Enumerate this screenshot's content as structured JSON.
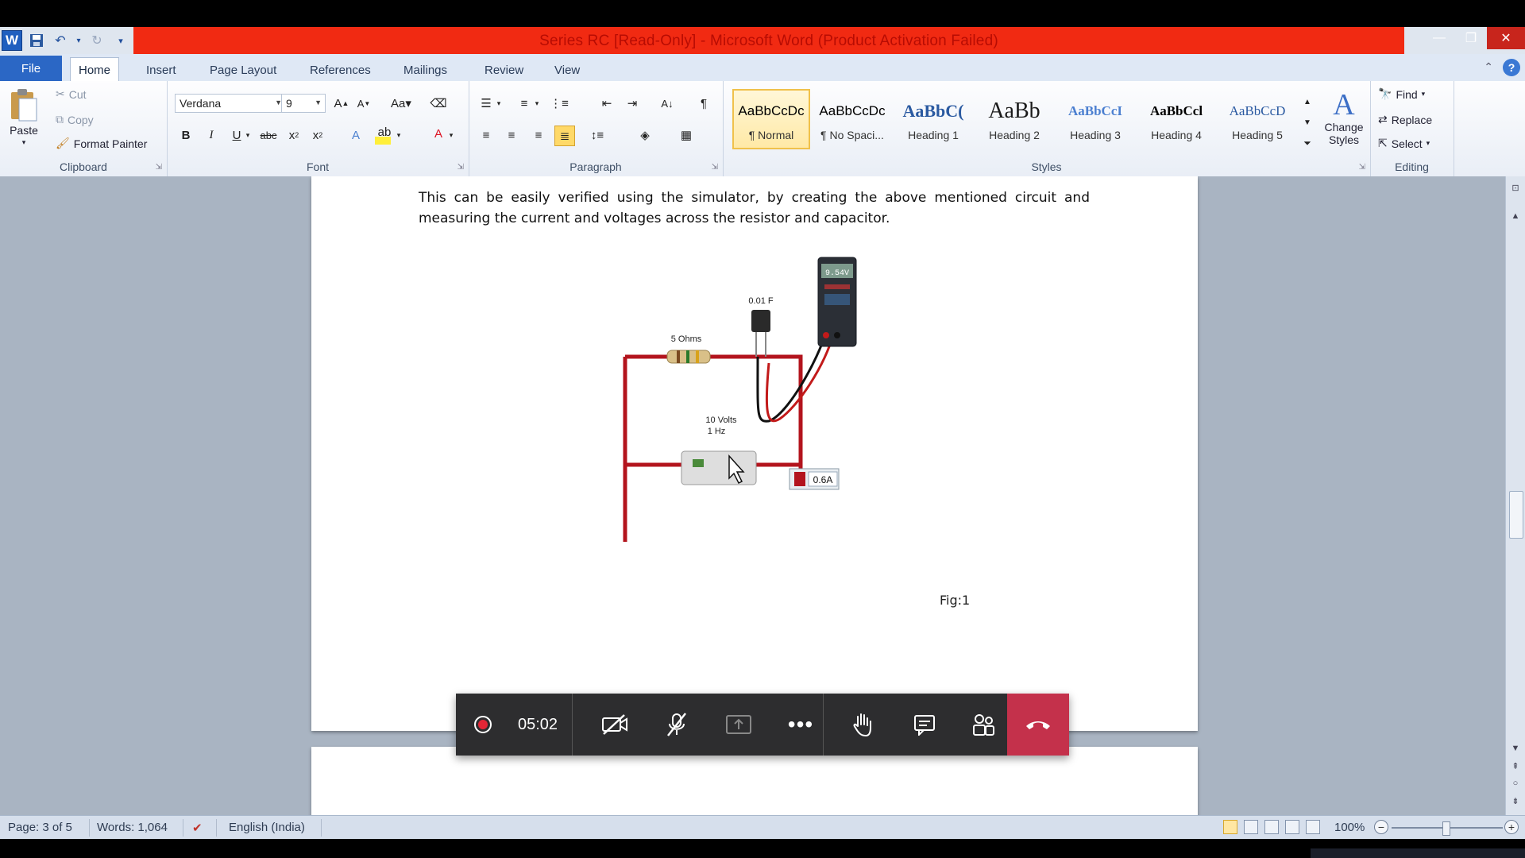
{
  "window": {
    "title": "Series RC [Read-Only] - Microsoft Word (Product Activation Failed)"
  },
  "tabs": [
    "File",
    "Home",
    "Insert",
    "Page Layout",
    "References",
    "Mailings",
    "Review",
    "View"
  ],
  "clipboard": {
    "paste": "Paste",
    "cut": "Cut",
    "copy": "Copy",
    "format_painter": "Format Painter",
    "label": "Clipboard"
  },
  "font": {
    "name": "Verdana",
    "size": "9",
    "label": "Font"
  },
  "paragraph": {
    "label": "Paragraph"
  },
  "styles": {
    "label": "Styles",
    "items": [
      {
        "preview": "AaBbCcDc",
        "name": "¶ Normal"
      },
      {
        "preview": "AaBbCcDc",
        "name": "¶ No Spaci..."
      },
      {
        "preview": "AaBbC(",
        "name": "Heading 1"
      },
      {
        "preview": "AaBb",
        "name": "Heading 2"
      },
      {
        "preview": "AaBbCcI",
        "name": "Heading 3"
      },
      {
        "preview": "AaBbCcl",
        "name": "Heading 4"
      },
      {
        "preview": "AaBbCcD",
        "name": "Heading 5"
      }
    ],
    "change_styles": "Change Styles"
  },
  "editing": {
    "find": "Find",
    "replace": "Replace",
    "select": "Select",
    "label": "Editing"
  },
  "document": {
    "paragraph": "This can be easily verified using the simulator, by creating the above mentioned circuit and measuring the current and voltages across the resistor and capacitor.",
    "figure_caption": "Fig:1",
    "circuit": {
      "capacitor_label": "0.01 F",
      "resistor_label": "5 Ohms",
      "source_label_1": "10 Volts",
      "source_label_2": "1 Hz",
      "voltmeter_reading": "9.54V",
      "ammeter_reading": "0.6A"
    }
  },
  "meeting": {
    "timer": "05:02"
  },
  "status": {
    "page": "Page: 3 of 5",
    "words": "Words: 1,064",
    "language": "English (India)",
    "zoom": "100%"
  },
  "colors": {
    "title_bar_red": "#f12a12",
    "file_tab": "#2b67c5",
    "hangup": "#c4314b"
  }
}
